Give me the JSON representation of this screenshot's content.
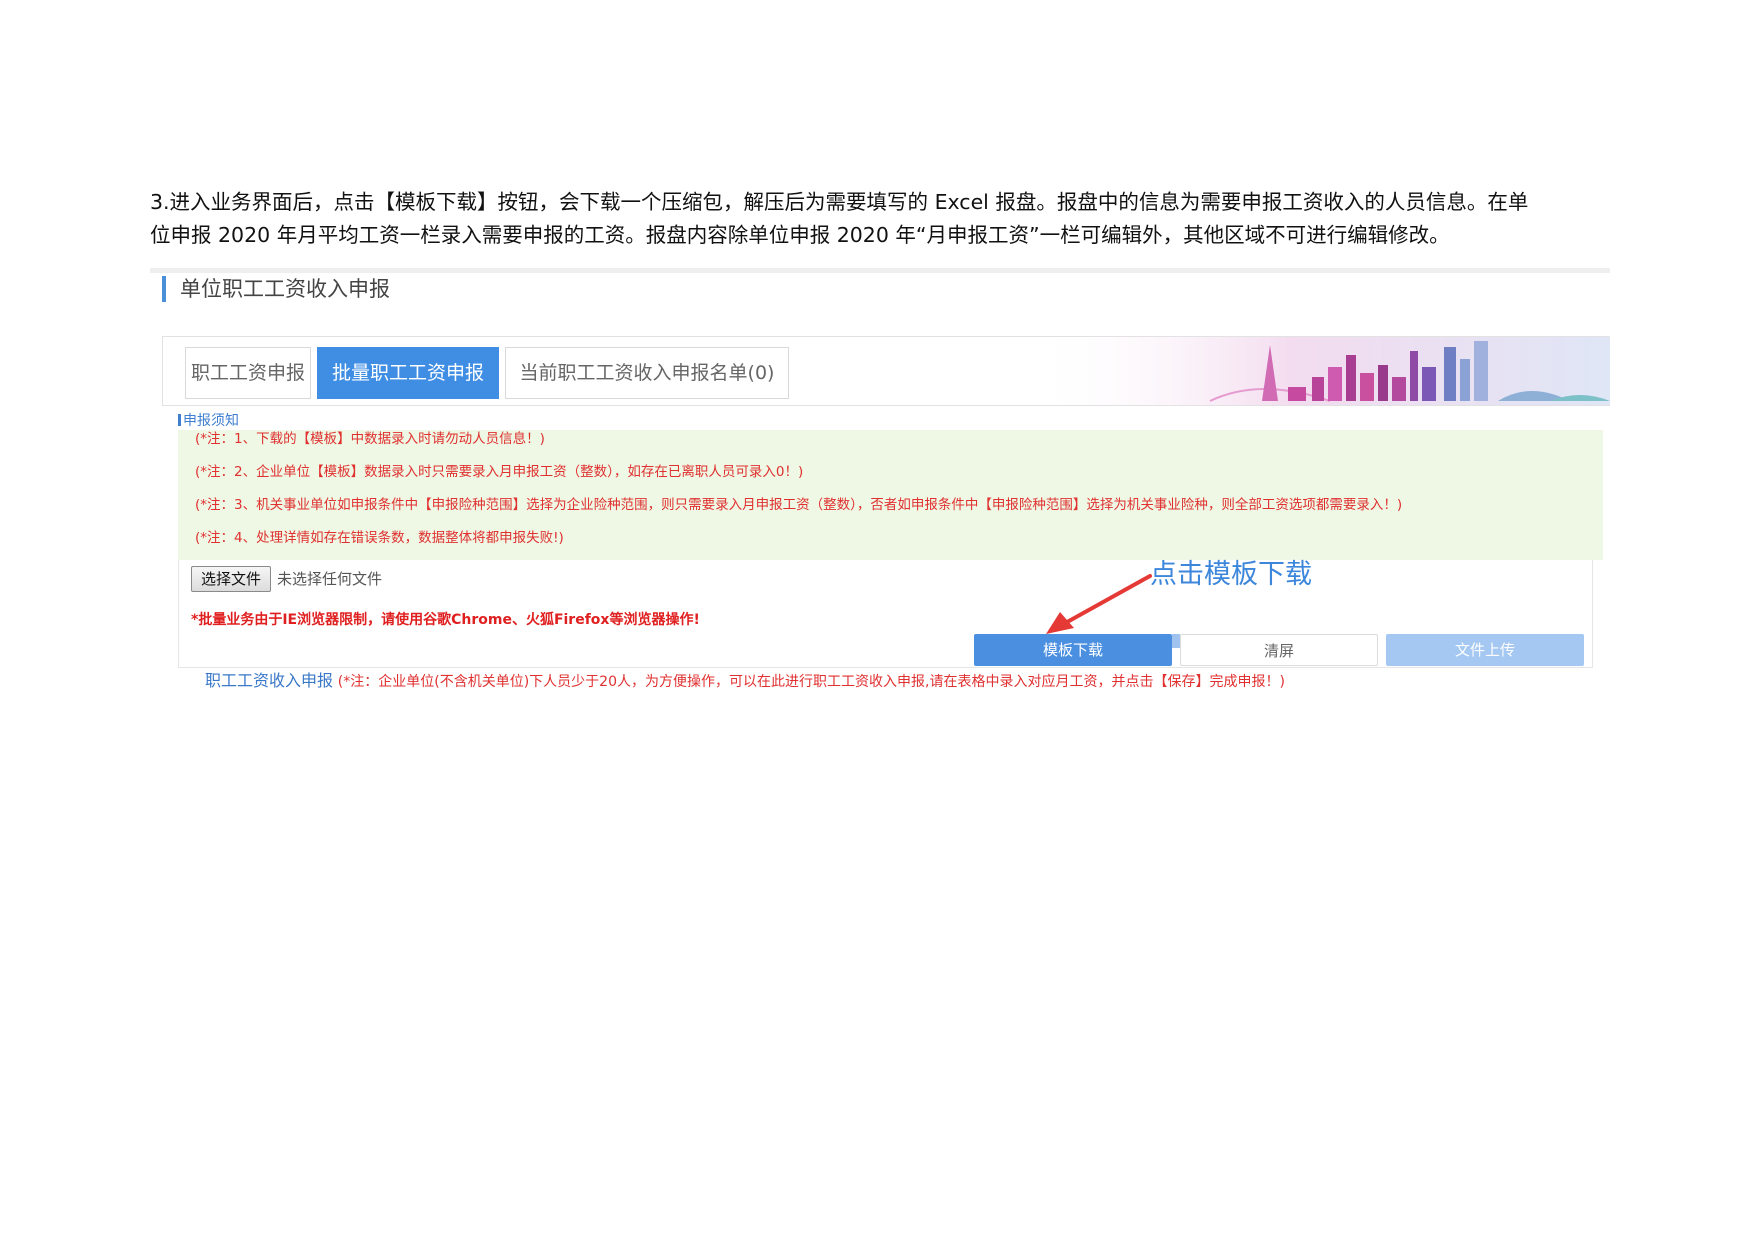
{
  "instruction": {
    "line1": "3.进入业务界面后，点击【模板下载】按钮，会下载一个压缩包，解压后为需要填写的 Excel 报盘。报盘中的信息为需要申报工资收入的人员信息。在单",
    "line2": "位申报 2020 年月平均工资一栏录入需要申报的工资。报盘内容除单位申报 2020 年“月申报工资”一栏可编辑外，其他区域不可进行编辑修改。"
  },
  "section": {
    "title": "单位职工工资收入申报"
  },
  "tabs": [
    {
      "label": "职工工资申报",
      "active": false
    },
    {
      "label": "批量职工工资申报",
      "active": true
    },
    {
      "label": "当前职工工资收入申报名单(0)",
      "active": false
    }
  ],
  "notice": {
    "label": "申报须知",
    "items": [
      "(*注：1、下载的【模板】中数据录入时请勿动人员信息！)",
      "(*注：2、企业单位【模板】数据录入时只需要录入月申报工资（整数），如存在已离职人员可录入0！)",
      "(*注：3、机关事业单位如申报条件中【申报险种范围】选择为企业险种范围，则只需要录入月申报工资（整数），否者如申报条件中【申报险种范围】选择为机关事业险种，则全部工资选项都需要录入！)",
      "(*注：4、处理详情如存在错误条数，数据整体将都申报失败!)"
    ]
  },
  "upload": {
    "choose_file_label": "选择文件",
    "file_status": "未选择任何文件",
    "browser_warning": "*批量业务由于IE浏览器限制，请使用谷歌Chrome、火狐Firefox等浏览器操作!"
  },
  "actions": {
    "template_download": "模板下载",
    "clear_screen": "清屏",
    "file_upload": "文件上传"
  },
  "annotation": {
    "label": "点击模板下载",
    "color": "#e53935"
  },
  "footer": {
    "link": "职工工资收入申报",
    "note": "(*注：企业单位(不含机关单位)下人员少于20人，为方便操作，可以在此进行职工工资收入申报,请在表格中录入对应月工资，并点击【保存】完成申报！)"
  },
  "colors": {
    "accent": "#3f8ee4",
    "warning_text": "#e03030",
    "notice_background": "#eef8e4",
    "link": "#3a78c8"
  }
}
